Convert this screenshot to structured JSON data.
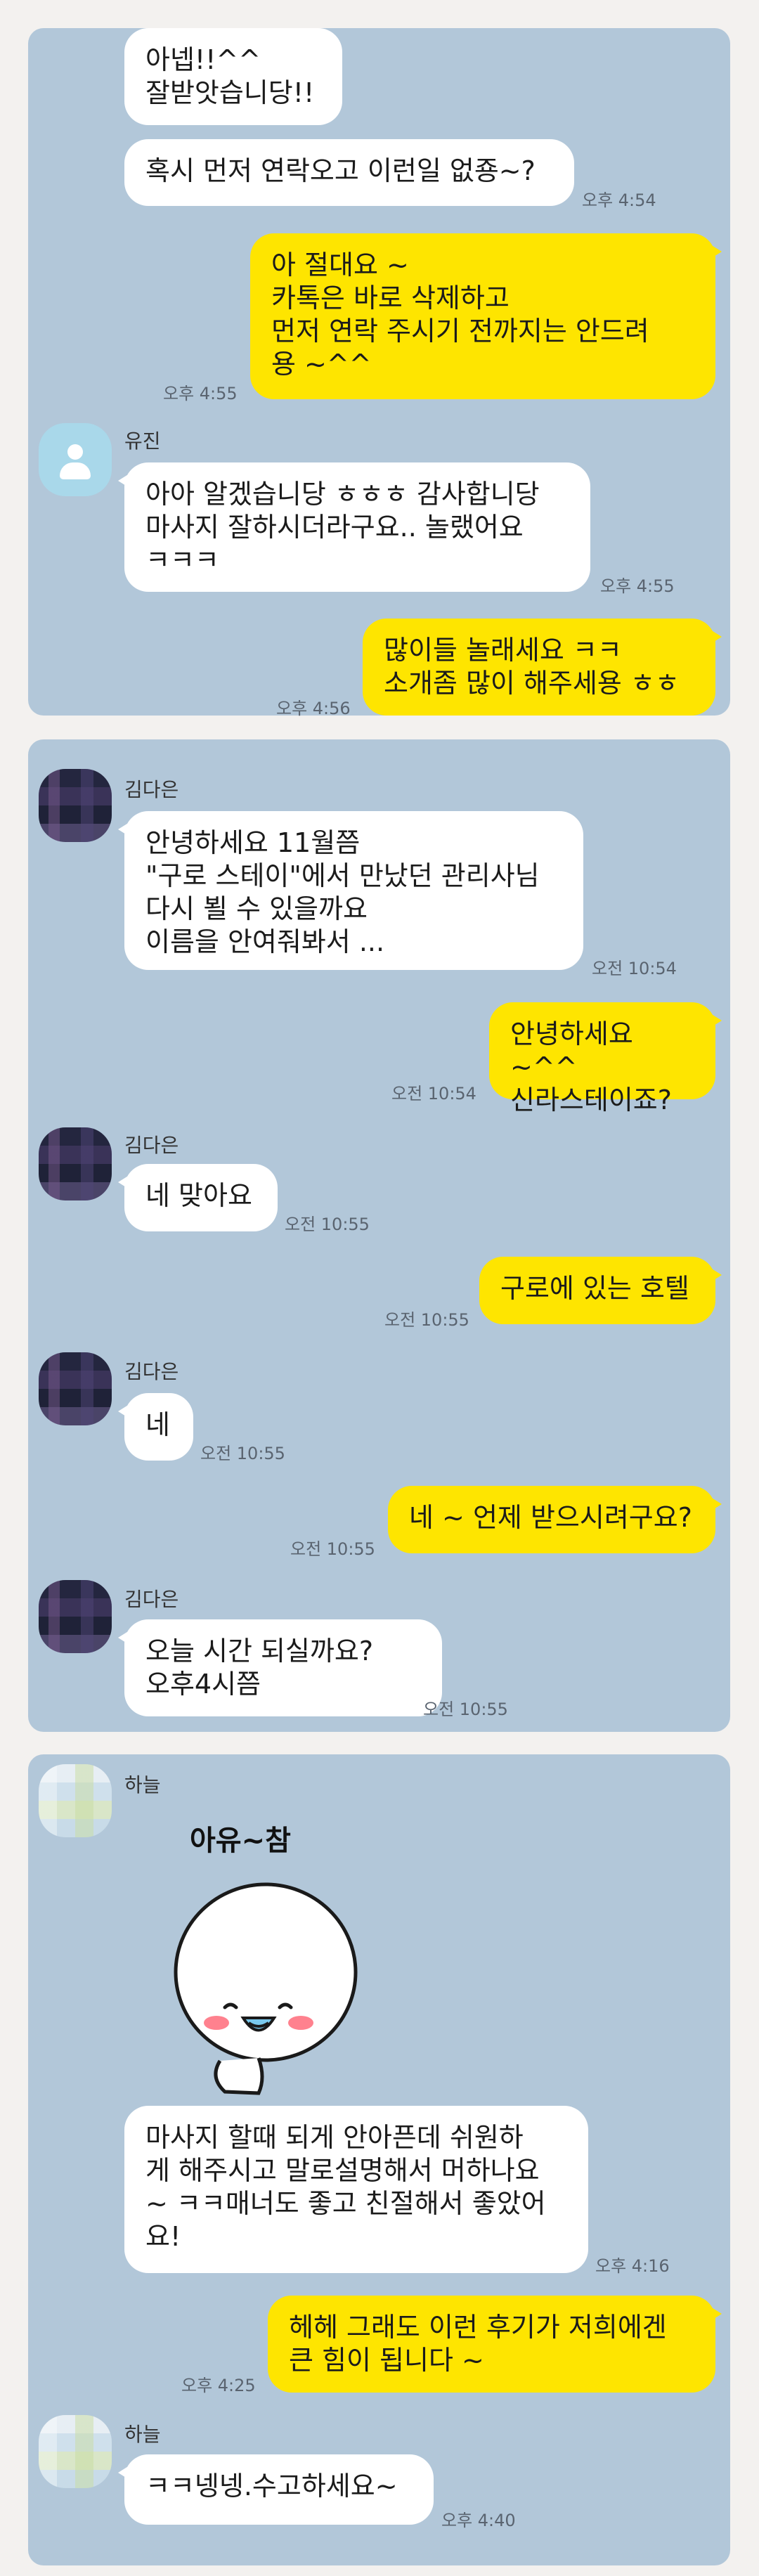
{
  "conversations": [
    {
      "messages": [
        {
          "text": "아넵!!^^\n잘받앗습니당!!"
        },
        {
          "text": "혹시 먼저 연락오고 이런일 없죵~?",
          "time": "오후 4:54"
        },
        {
          "text": "아 절대요 ~\n카톡은 바로 삭제하고\n먼저 연락 주시기 전까지는 안드려\n용 ~^^",
          "time": "오후 4:55"
        },
        {
          "sender": "유진",
          "text": "아아 알겠습니당 ㅎㅎㅎ 감사합니당\n마사지 잘하시더라구요.. 놀랬어요\nㅋㅋㅋ",
          "time": "오후 4:55"
        },
        {
          "text": "많이들 놀래세요 ㅋㅋ\n소개좀 많이 해주세용 ㅎㅎ",
          "time": "오후 4:56"
        }
      ]
    },
    {
      "messages": [
        {
          "sender": "김다은",
          "text": "안녕하세요 11월쯤\n\"구로 스테이\"에서 만났던 관리사님\n다시 뵐 수 있을까요\n이름을 안여줘봐서 ...",
          "time": "오전 10:54"
        },
        {
          "text": "안녕하세요 ~^^\n신라스테이죠?",
          "time": "오전 10:54"
        },
        {
          "sender": "김다은",
          "text": "네 맞아요",
          "time": "오전 10:55"
        },
        {
          "text": "구로에 있는 호텔",
          "time": "오전 10:55"
        },
        {
          "sender": "김다은",
          "text": "네",
          "time": "오전 10:55"
        },
        {
          "text": "네 ~ 언제 받으시려구요?",
          "time": "오전 10:55"
        },
        {
          "sender": "김다은",
          "text": "오늘  시간 되실까요?\n오후4시쯤",
          "time": "오전 10:55"
        }
      ]
    },
    {
      "messages": [
        {
          "sender": "하늘",
          "sticker_text": "아유~참"
        },
        {
          "text": "마사지 할때 되게 안아픈데 쉬원하\n게 해주시고 말로설명해서 머하나요\n~ ㅋㅋ매너도 좋고 친절해서 좋았어\n요!",
          "time": "오후 4:16"
        },
        {
          "text": "헤헤 그래도 이런 후기가 저희에겐\n큰 힘이 됩니다 ~",
          "time": "오후 4:25"
        },
        {
          "sender": "하늘",
          "text": "ㅋㅋ넹넹.수고하세요~",
          "time": "오후 4:40"
        }
      ]
    }
  ],
  "colors": {
    "panel": "#b2c7d9",
    "incoming": "#ffffff",
    "outgoing": "#fee500",
    "background": "#f3f1ef"
  },
  "icons": [
    "default-profile-icon",
    "smile-blush-sticker"
  ]
}
